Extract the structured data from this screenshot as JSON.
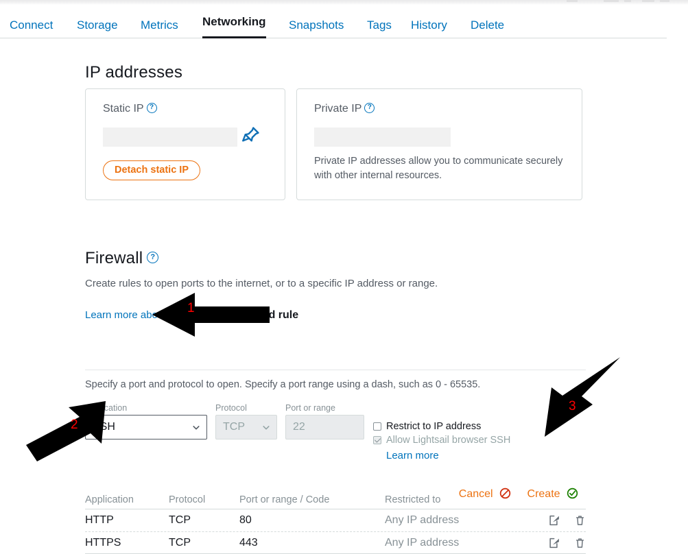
{
  "tabs": [
    {
      "label": "Connect",
      "active": false
    },
    {
      "label": "Storage",
      "active": false
    },
    {
      "label": "Metrics",
      "active": false
    },
    {
      "label": "Networking",
      "active": true
    },
    {
      "label": "Snapshots",
      "active": false
    },
    {
      "label": "Tags",
      "active": false
    },
    {
      "label": "History",
      "active": false
    },
    {
      "label": "Delete",
      "active": false
    }
  ],
  "ip_section": {
    "title": "IP addresses",
    "static_card": {
      "label": "Static IP",
      "help": "?",
      "value": "",
      "pin_icon": "pushpin-icon",
      "detach_label": "Detach static IP"
    },
    "private_card": {
      "label": "Private IP",
      "help": "?",
      "value": "",
      "note": "Private IP addresses allow you to communicate securely with other internal resources."
    }
  },
  "firewall": {
    "title": "Firewall",
    "help": "?",
    "description": "Create rules to open ports to the internet, or to a specific IP address or range.",
    "learn_more_link": "Learn more about firewall rules",
    "external_icon": "external-link-icon",
    "add_rule_label": "Add rule",
    "add_rule_plus": "+",
    "specify_note": "Specify a port and protocol to open. Specify a port range using a dash, such as 0 - 65535.",
    "form": {
      "application": {
        "label": "Application",
        "value": "SSH",
        "disabled": false
      },
      "protocol": {
        "label": "Protocol",
        "value": "TCP",
        "disabled": true
      },
      "port": {
        "label": "Port or range",
        "value": "22",
        "disabled": true
      },
      "restrict_checkbox": {
        "label": "Restrict to IP address",
        "checked": false,
        "disabled": false
      },
      "browser_ssh_checkbox": {
        "label": "Allow Lightsail browser SSH",
        "checked": true,
        "disabled": true
      },
      "learn_more": "Learn more"
    },
    "actions": {
      "cancel_label": "Cancel",
      "cancel_icon": "no-entry-icon",
      "create_label": "Create",
      "create_icon": "check-circle-icon"
    },
    "table": {
      "headers": [
        "Application",
        "Protocol",
        "Port or range / Code",
        "Restricted to"
      ],
      "rows": [
        {
          "application": "HTTP",
          "protocol": "TCP",
          "port": "80",
          "restricted_to": "Any IP address",
          "edit_icon": "edit-icon",
          "delete_icon": "trash-icon"
        },
        {
          "application": "HTTPS",
          "protocol": "TCP",
          "port": "443",
          "restricted_to": "Any IP address",
          "edit_icon": "edit-icon",
          "delete_icon": "trash-icon"
        }
      ]
    }
  },
  "annotations": [
    {
      "number": "1",
      "direction": "left",
      "target": "add-rule"
    },
    {
      "number": "2",
      "direction": "up-right",
      "target": "application-select"
    },
    {
      "number": "3",
      "direction": "down-left",
      "target": "create-button"
    }
  ],
  "colors": {
    "link": "#0073bb",
    "accent_orange": "#ec7211",
    "text": "#16191f",
    "muted": "#879196",
    "annotation_red": "#ff0000",
    "success_green": "#1d8102",
    "danger_red": "#d13212"
  }
}
